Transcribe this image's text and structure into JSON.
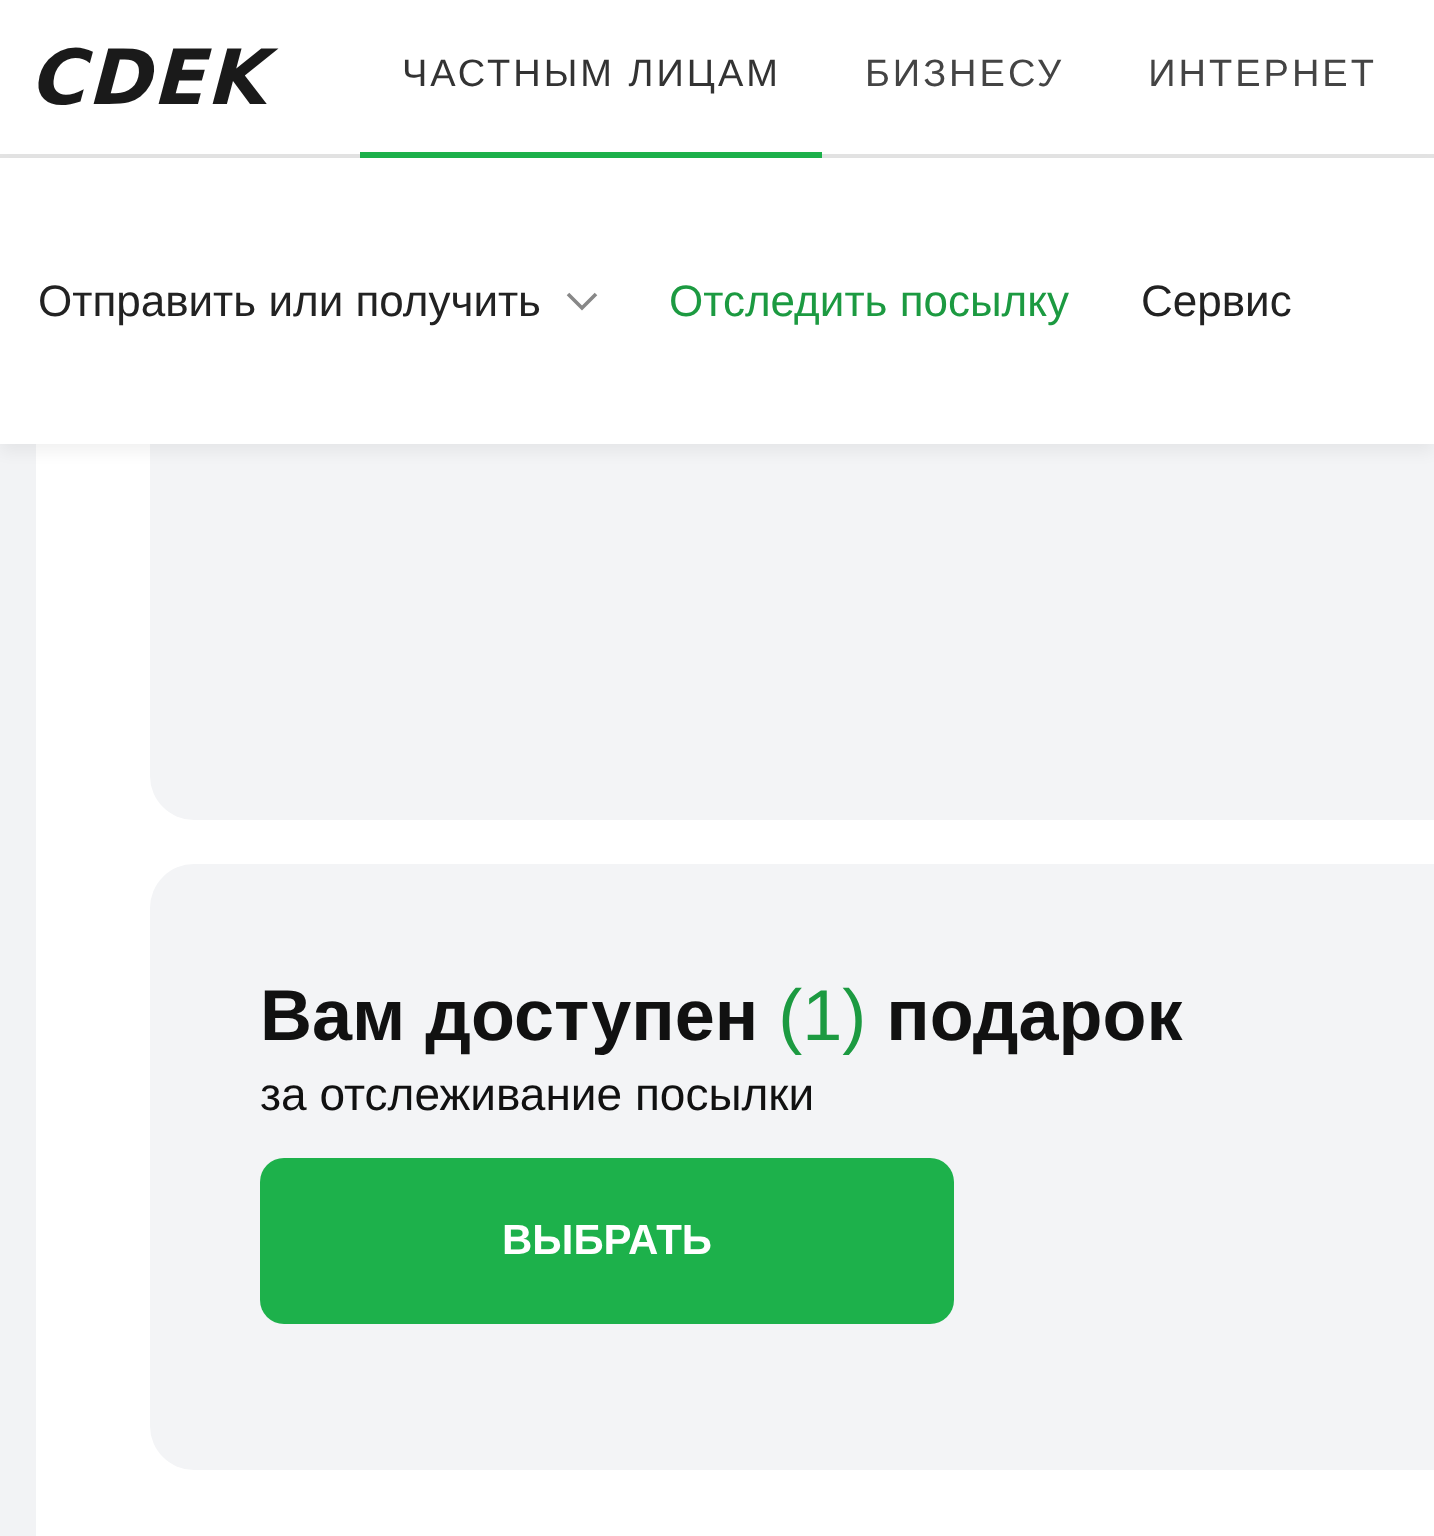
{
  "header": {
    "logo": "CDEK",
    "tabs": [
      {
        "label": "ЧАСТНЫМ ЛИЦАМ",
        "selected": true
      },
      {
        "label": "БИЗНЕСУ",
        "selected": false
      },
      {
        "label": "ИНТЕРНЕТ",
        "selected": false
      }
    ]
  },
  "subnav": [
    {
      "label": "Отправить или получить",
      "selected": false,
      "dropdown": true
    },
    {
      "label": "Отследить посылку",
      "selected": true,
      "dropdown": false
    },
    {
      "label": "Сервис",
      "selected": false,
      "dropdown": false
    }
  ],
  "gift_card": {
    "title_before": "Вам доступен",
    "count": "(1)",
    "title_after": "подарок",
    "subtitle": "за отслеживание посылки",
    "button": "ВЫБРАТЬ"
  }
}
